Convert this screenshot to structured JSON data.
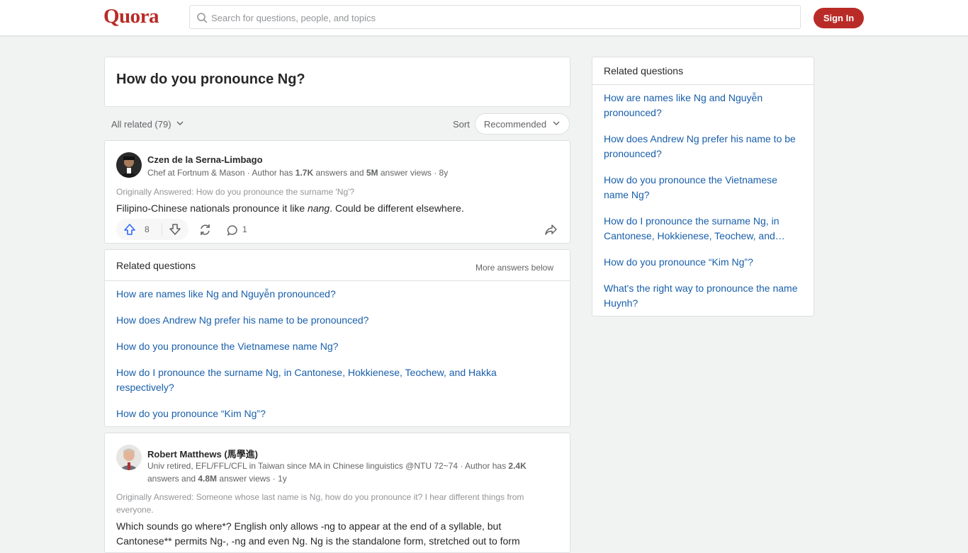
{
  "header": {
    "logo": "Quora",
    "search_placeholder": "Search for questions, people, and topics",
    "signin_label": "Sign In"
  },
  "question": {
    "title": "How do you pronounce Ng?"
  },
  "filters": {
    "all_related": "All related (79)",
    "sort_label": "Sort",
    "sort_value": "Recommended"
  },
  "answers": [
    {
      "author": "Czen de la Serna-Limbago",
      "cred_prefix": "Chef at Fortnum & Mason · Author has ",
      "answers_count": "1.7K",
      "cred_mid": " answers and ",
      "views_count": "5M",
      "cred_suffix": " answer views · 8y",
      "originally": "Originally Answered: How do you pronounce the surname 'Ng'?",
      "text_before": "Filipino-Chinese nationals pronounce it like ",
      "text_em": "nang",
      "text_after": ". Could be different elsewhere.",
      "upvotes": "8",
      "comments": "1"
    },
    {
      "author": "Robert Matthews (馬學進)",
      "cred_prefix": "Univ retired, EFL/FFL/CFL in Taiwan since MA in Chinese linguistics @NTU 72~74 · Author has ",
      "answers_count": "2.4K",
      "cred_mid": " answers and ",
      "views_count": "4.8M",
      "cred_suffix": " answer views · 1y",
      "originally": "Originally Answered: Someone whose last name is Ng, how do you pronounce it? I hear different things from everyone.",
      "text": "Which sounds go where*? English only allows -ng to appear at the end of a syllable, but Cantonese** permits Ng-, -ng and even Ng. Ng is the standalone form, stretched out to form"
    }
  ],
  "inline_related": {
    "heading": "Related questions",
    "more_below": "More answers below",
    "links": [
      "How are names like Ng and Nguyễn pronounced?",
      "How does Andrew Ng prefer his name to be pronounced?",
      "How do you pronounce the Vietnamese name Ng?",
      "How do I pronounce the surname Ng, in Cantonese, Hokkienese, Teochew, and Hakka respectively?",
      "How do you pronounce “Kim Ng”?"
    ]
  },
  "sidebar": {
    "heading": "Related questions",
    "links": [
      "How are names like Ng and Nguyễn pronounced?",
      "How does Andrew Ng prefer his name to be pronounced?",
      "How do you pronounce the Vietnamese name Ng?",
      "How do I pronounce the surname Ng, in Cantonese, Hokkienese, Teochew, and…",
      "How do you pronounce “Kim Ng”?",
      "What's the right way to pronounce the name Huynh?"
    ]
  },
  "colors": {
    "brand": "#b92b27",
    "link": "#195faa",
    "upvote": "#2e69ff"
  }
}
